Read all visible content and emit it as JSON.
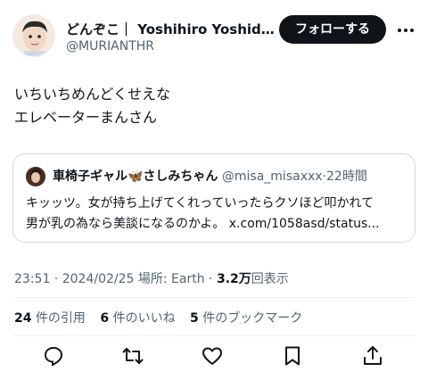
{
  "author": {
    "name": "どんぞこ｜ Yoshihiro Yoshida...",
    "handle": "@MURIANTHR",
    "follow_label": "フォローする"
  },
  "tweet": {
    "line1": "いちいちめんどくせえな",
    "line2": "エレベーターまんさん"
  },
  "quote": {
    "name": "車椅子ギャル🦋さしみちゃん",
    "handle": "@misa_misaxxx",
    "time": "22時間",
    "text_line1": "キッッツ。女が持ち上げてくれっていったらクソほど叩かれて",
    "text_line2": "男が乳の為なら美談になるのかよ。",
    "link": "x.com/1058asd/status..."
  },
  "meta": {
    "time": "23:51",
    "date": "2024/02/25",
    "location_label": "場所: Earth",
    "views_count": "3.2万",
    "views_label": "回表示"
  },
  "stats": {
    "quotes_count": "24",
    "quotes_label": "件の引用",
    "likes_count": "6",
    "likes_label": "件のいいね",
    "bookmarks_count": "5",
    "bookmarks_label": "件のブックマーク"
  },
  "actions": [
    "reply-icon",
    "repost-icon",
    "like-icon",
    "bookmark-icon",
    "share-icon"
  ],
  "colors": {
    "text": "#0f1419",
    "muted": "#536471",
    "border": "#cfd9de",
    "button": "#0f1419"
  }
}
